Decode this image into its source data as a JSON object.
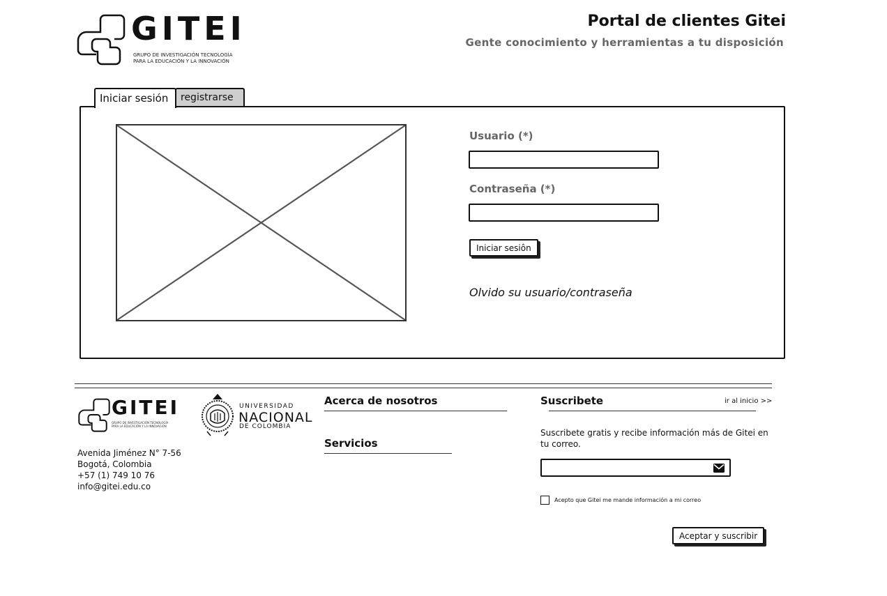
{
  "header": {
    "logo_word": "GITEI",
    "logo_subtitle_line1": "GRUPO DE INVESTIGACIÓN TECNOLOGÍA",
    "logo_subtitle_line2": "PARA LA EDUCACIÓN Y LA INNOVACIÓN",
    "portal_title": "Portal de clientes Gitei",
    "portal_subtitle": "Gente conocimiento y herramientas a tu disposición"
  },
  "tabs": [
    {
      "label": "Iniciar sesión",
      "active": true
    },
    {
      "label": "registrarse",
      "active": false
    }
  ],
  "login": {
    "user_label": "Usuario (*)",
    "user_value": "",
    "password_label": "Contraseña (*)",
    "password_value": "",
    "submit_label": "Iniciar sesiôn",
    "forgot_label": "Olvido su usuario/contraseña"
  },
  "footer": {
    "logo_word": "GITEI",
    "logo_subtitle_line1": "GRUPO DE INVESTIGACIÓN TECNOLOGÍA",
    "logo_subtitle_line2": "PARA LA EDUCACIÓN Y LA INNOVACIÓN",
    "university": {
      "line1": "UNIVERSIDAD",
      "line2": "NACIONAL",
      "line3": "DE COLOMBIA"
    },
    "address": [
      "Avenida Jiménez N° 7-56",
      "Bogotá, Colombia",
      "+57 (1) 749 10 76",
      "info@gitei.edu.co"
    ],
    "about_heading": "Acerca de nosotros",
    "services_heading": "Servicios",
    "subscribe_heading": "Suscribete",
    "back_to_top": "ir al inicio >>",
    "subscribe_text": "Suscribete gratis y recibe información más de Gitei en tu correo.",
    "email_value": "",
    "consent_label": "Acepto que Gitei me mande información a mi correo",
    "consent_checked": false,
    "subscribe_button": "Aceptar y suscribir"
  },
  "icons": {
    "email": "envelope-icon",
    "image": "image-placeholder-icon"
  }
}
